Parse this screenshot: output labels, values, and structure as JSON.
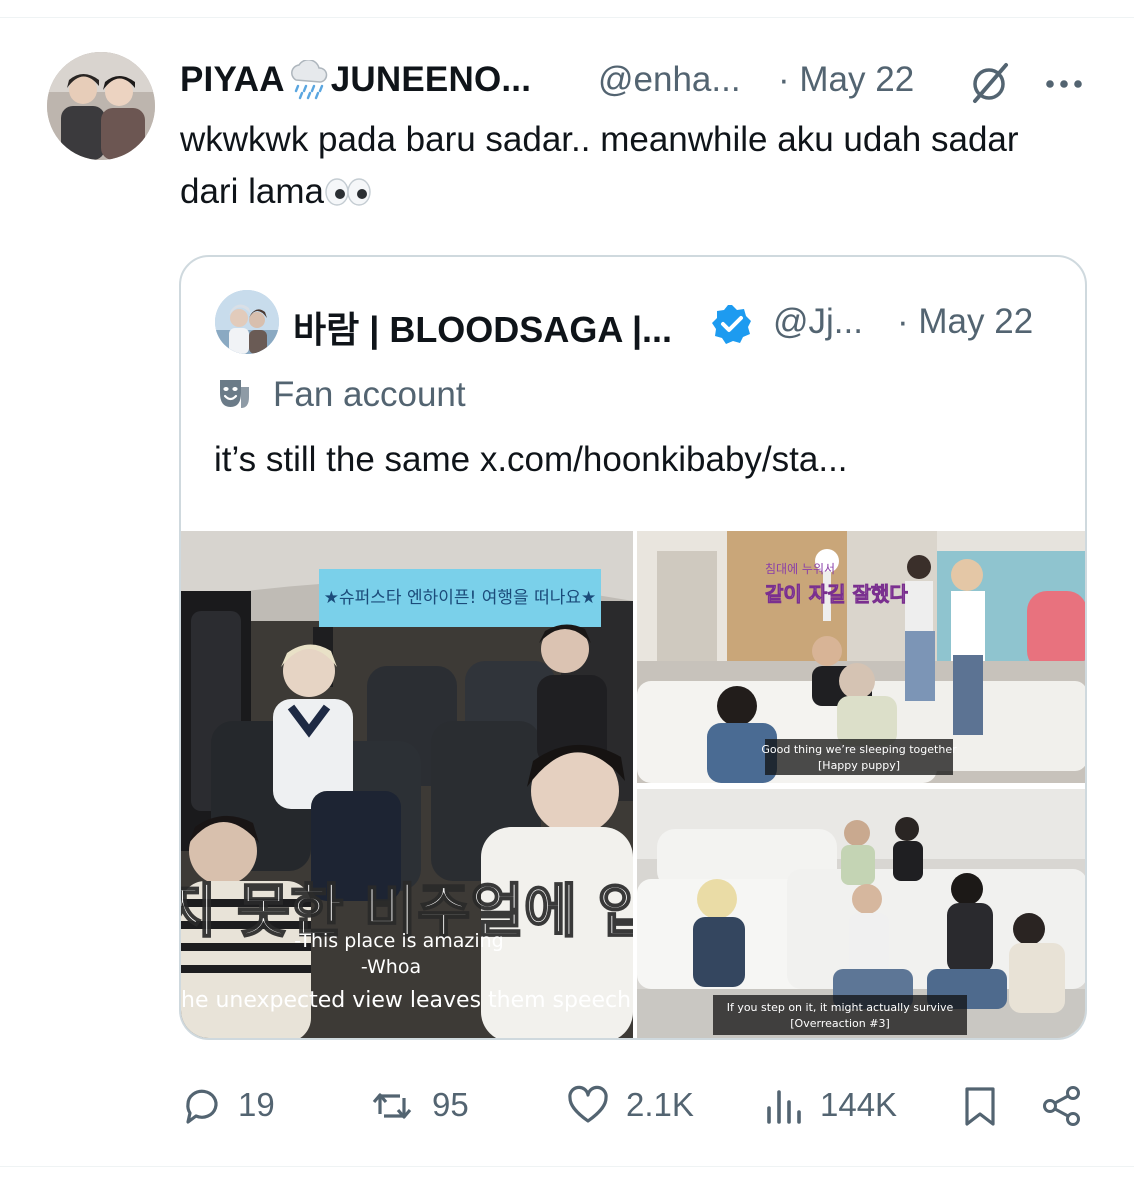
{
  "tweet": {
    "display_name_part1": "PIYAA",
    "display_name_part2": "JUNEENO...",
    "handle": "@enha...",
    "date": "· May 22",
    "text": "wkwkwk pada baru sadar.. meanwhile aku udah sadar dari lama",
    "emoji_icons": [
      "cloud-rain-icon",
      "eyes-icon"
    ]
  },
  "quote": {
    "display_name": "바람 | BLOODSAGA |...",
    "verified": true,
    "handle": "@Jj...",
    "date": "· May 22",
    "badge_label": "Fan account",
    "text": "it’s still the same  x.com/hoonkibaby/sta...",
    "media": [
      {
        "banner": "★슈퍼스타 엔하이픈! 여행을 떠나요★",
        "caption_kr": "지 못한 비주얼에 입",
        "caption_line1": "-This place is amazing",
        "caption_line2": "-Whoa",
        "caption_line3": "he unexpected view leaves them speechles"
      },
      {
        "overlay_small": "침대에 누워서",
        "overlay_kr": "같이 자길 잘했다",
        "caption_line1": "Good thing we’re sleeping together",
        "caption_line2": "[Happy puppy]"
      },
      {
        "caption_line1": "If you step on it, it might actually survive",
        "caption_line2": "[Overreaction #3]"
      }
    ]
  },
  "actions": {
    "replies": "19",
    "reposts": "95",
    "likes": "2.1K",
    "views": "144K"
  },
  "colors": {
    "text": "#0f1419",
    "secondary": "#536471",
    "border": "#cfd9de",
    "verified": "#1d9bf0"
  }
}
